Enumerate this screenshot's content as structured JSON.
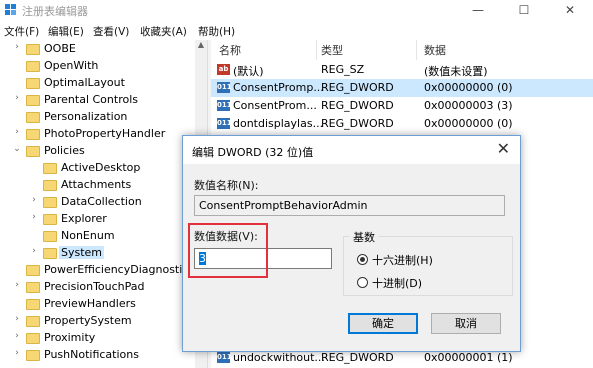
{
  "window": {
    "title": "注册表编辑器",
    "minimize_glyph": "—",
    "maximize_glyph": "☐",
    "close_glyph": "✕"
  },
  "menu": [
    "文件(F)",
    "编辑(E)",
    "查看(V)",
    "收藏夹(A)",
    "帮助(H)"
  ],
  "tree": {
    "items": [
      {
        "label": "OOBE",
        "arrow": "›"
      },
      {
        "label": "OpenWith",
        "arrow": ""
      },
      {
        "label": "OptimalLayout",
        "arrow": ""
      },
      {
        "label": "Parental Controls",
        "arrow": "›"
      },
      {
        "label": "Personalization",
        "arrow": ""
      },
      {
        "label": "PhotoPropertyHandler",
        "arrow": "›"
      },
      {
        "label": "Policies",
        "arrow": "⌄"
      },
      {
        "label": "ActiveDesktop",
        "arrow": ""
      },
      {
        "label": "Attachments",
        "arrow": ""
      },
      {
        "label": "DataCollection",
        "arrow": "›"
      },
      {
        "label": "Explorer",
        "arrow": "›"
      },
      {
        "label": "NonEnum",
        "arrow": ""
      },
      {
        "label": "System",
        "arrow": "›"
      },
      {
        "label": "PowerEfficiencyDiagnostics",
        "arrow": ""
      },
      {
        "label": "PrecisionTouchPad",
        "arrow": "›"
      },
      {
        "label": "PreviewHandlers",
        "arrow": ""
      },
      {
        "label": "PropertySystem",
        "arrow": "›"
      },
      {
        "label": "Proximity",
        "arrow": "›"
      },
      {
        "label": "PushNotifications",
        "arrow": "›"
      }
    ]
  },
  "list": {
    "headers": {
      "name": "名称",
      "type": "类型",
      "data": "数据"
    },
    "rows": [
      {
        "icon": "ab",
        "name": "(默认)",
        "type": "REG_SZ",
        "data": "(数值未设置)"
      },
      {
        "icon": "011",
        "name": "ConsentPromp...",
        "type": "REG_DWORD",
        "data": "0x00000000 (0)"
      },
      {
        "icon": "011",
        "name": "ConsentProm...",
        "type": "REG_DWORD",
        "data": "0x00000003 (3)"
      },
      {
        "icon": "011",
        "name": "dontdisplaylas...",
        "type": "REG_DWORD",
        "data": "0x00000000 (0)"
      },
      {
        "icon": "011",
        "name": "undockwithout...",
        "type": "REG_DWORD",
        "data": "0x00000001 (1)"
      }
    ]
  },
  "dialog": {
    "title": "编辑 DWORD (32 位)值",
    "name_label": "数值名称(N):",
    "name_value": "ConsentPromptBehaviorAdmin",
    "data_label": "数值数据(V):",
    "data_value": "3",
    "base_label": "基数",
    "hex_option": "十六进制(H)",
    "dec_option": "十进制(D)",
    "selected_base": "hex",
    "ok_label": "确定",
    "cancel_label": "取消"
  },
  "colors": {
    "selection": "#cce8ff",
    "folder": "#f7d774",
    "highlight_box": "#e2313c",
    "dialog_border": "#6d9ed8",
    "accent": "#0078d7"
  }
}
